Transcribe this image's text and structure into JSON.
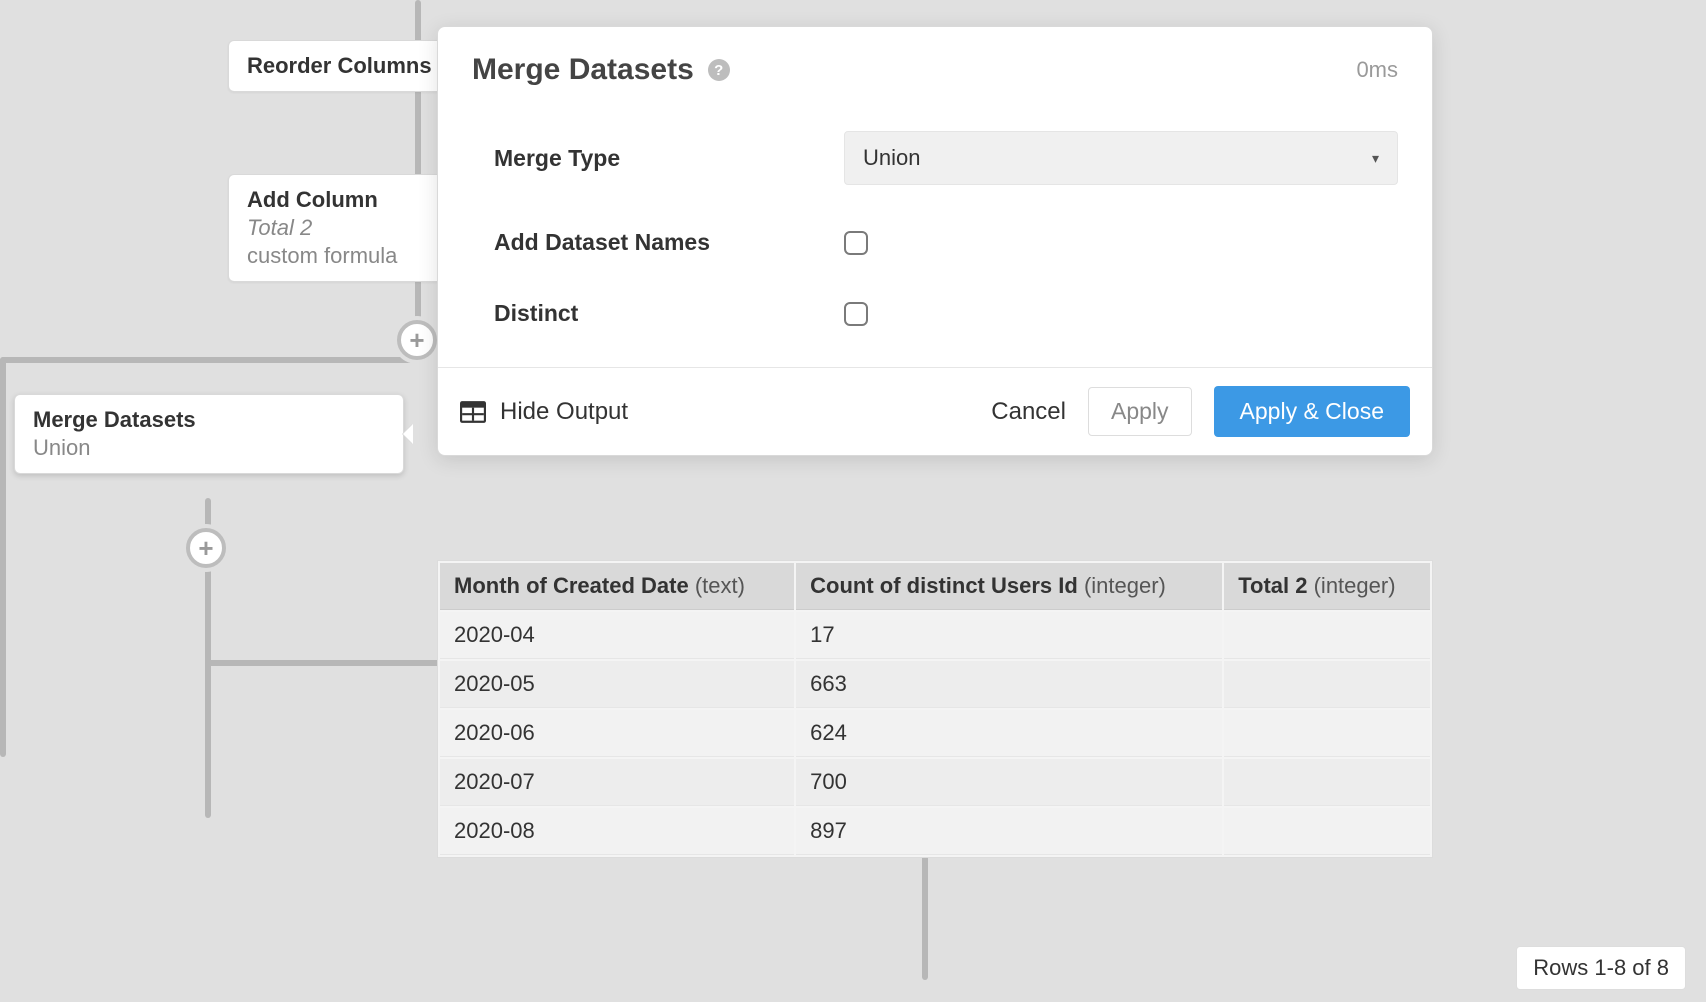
{
  "workflow": {
    "nodes": {
      "reorder": {
        "title": "Reorder Columns"
      },
      "addcol": {
        "title": "Add Column",
        "sub1": "Total 2",
        "sub2": "custom formula"
      },
      "merge": {
        "title": "Merge Datasets",
        "sub2": "Union"
      }
    }
  },
  "panel": {
    "title": "Merge Datasets",
    "exec_time": "0ms",
    "fields": {
      "merge_type": {
        "label": "Merge Type",
        "value": "Union"
      },
      "add_names": {
        "label": "Add Dataset Names",
        "checked": false
      },
      "distinct": {
        "label": "Distinct",
        "checked": false
      }
    },
    "footer": {
      "hide_output": "Hide Output",
      "cancel": "Cancel",
      "apply": "Apply",
      "apply_close": "Apply & Close"
    }
  },
  "output": {
    "columns": [
      {
        "name": "Month of Created Date",
        "type": "(text)"
      },
      {
        "name": "Count of distinct Users Id",
        "type": "(integer)"
      },
      {
        "name": "Total 2",
        "type": "(integer)"
      }
    ],
    "rows": [
      {
        "c0": "2020-04",
        "c1": "17",
        "c2": ""
      },
      {
        "c0": "2020-05",
        "c1": "663",
        "c2": ""
      },
      {
        "c0": "2020-06",
        "c1": "624",
        "c2": ""
      },
      {
        "c0": "2020-07",
        "c1": "700",
        "c2": ""
      },
      {
        "c0": "2020-08",
        "c1": "897",
        "c2": ""
      }
    ],
    "rows_badge": "Rows 1-8 of 8"
  }
}
